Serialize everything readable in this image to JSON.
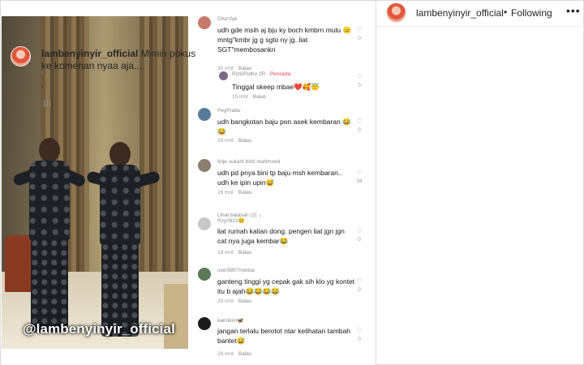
{
  "watermark": "@lambenyinyir_official",
  "post_header": {
    "handle": "lambenyinyir_official",
    "dot": "•",
    "follow_status": "Following",
    "more": "•••"
  },
  "caption": {
    "handle": "lambenyinyir_official",
    "text": "Mimin pokus ke komenan nyaa aja...",
    "dots": ".\n.",
    "time": "1h"
  },
  "comments": [
    {
      "user": "Cha^Aje",
      "text": "udh gde msih aj bju ky boch kmbrn mulu 😑mntg\"kmbr jg g sgto ny jg..liat SGT\"membosankn",
      "time": "30 mnt",
      "reply": "Balas",
      "likes": "0"
    },
    {
      "user": "RizkiRidho 2R",
      "creator_tag": "· Pencipta",
      "text": "Tinggal skeep mbae❤️🥰😇",
      "time": "15 mnt",
      "reply": "Balas",
      "likes": "0"
    },
    {
      "user": "PeyPrabu",
      "text": "udh bangkotan baju pon asek kembaran 😂😂",
      "time": "29 mnt",
      "reply": "Balas",
      "likes": "0"
    },
    {
      "user": "tinje sukarti binti mahmoed",
      "text": "udh pd pnya bini tp baju msh kembaran.. udh ke ipin upin😅",
      "time": "29 mnt",
      "reply": "Balas",
      "likes": "34"
    },
    {
      "user": "Rzy0922🥴",
      "text": "liat rumah kalian dong. pengen liat jgn jgn cat nya juga kembar😂",
      "time": "19 mnt",
      "reply": "Balas",
      "likes": "0"
    },
    {
      "user": "user5807melisa",
      "text": "ganteng tinggi yg cepak gak sih klo yg kontet itu b ajah😂😂😂😂",
      "time": "29 mnt",
      "reply": "Balas",
      "likes": "0"
    },
    {
      "user": "karinkim🦋",
      "text": "jangan terlalu berotot ntar kelihatan tambah bantet😅",
      "time": "29 mnt",
      "reply": "Balas",
      "likes": "0"
    }
  ],
  "view_replies": "Lihat balasan (3) ⌄",
  "icons": {
    "heart": "heart-icon",
    "more": "more-options-icon"
  },
  "colors": {
    "creator_tag": "#e0435d",
    "divider": "#dbdbdb",
    "muted": "#8e8e8e"
  }
}
